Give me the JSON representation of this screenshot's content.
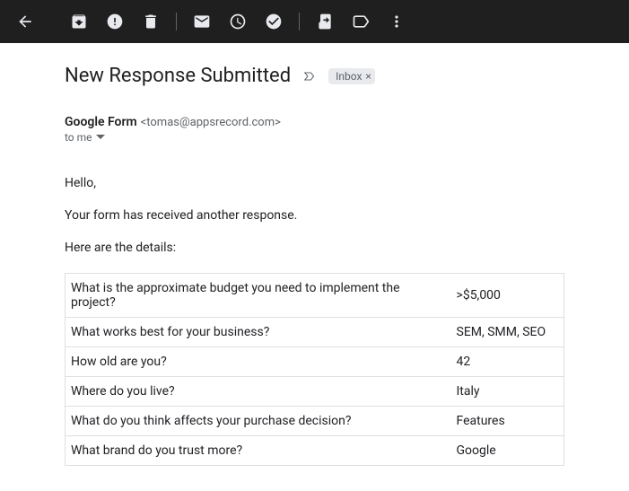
{
  "subject": "New Response Submitted",
  "label": "Inbox",
  "sender": {
    "name": "Google Form",
    "email": "<tomas@appsrecord.com>"
  },
  "to_line": "to me",
  "body": {
    "greeting": "Hello,",
    "line1": "Your form has received another response.",
    "line2": "Here are the details:"
  },
  "responses": [
    {
      "q": "What is the approximate budget you need to implement the project?",
      "a": ">$5,000"
    },
    {
      "q": "What works best for your business?",
      "a": "SEM, SMM, SEO"
    },
    {
      "q": "How old are you?",
      "a": "42"
    },
    {
      "q": "Where do you live?",
      "a": "Italy"
    },
    {
      "q": "What do you think affects your purchase decision?",
      "a": "Features"
    },
    {
      "q": "What brand do you trust more?",
      "a": "Google"
    }
  ]
}
